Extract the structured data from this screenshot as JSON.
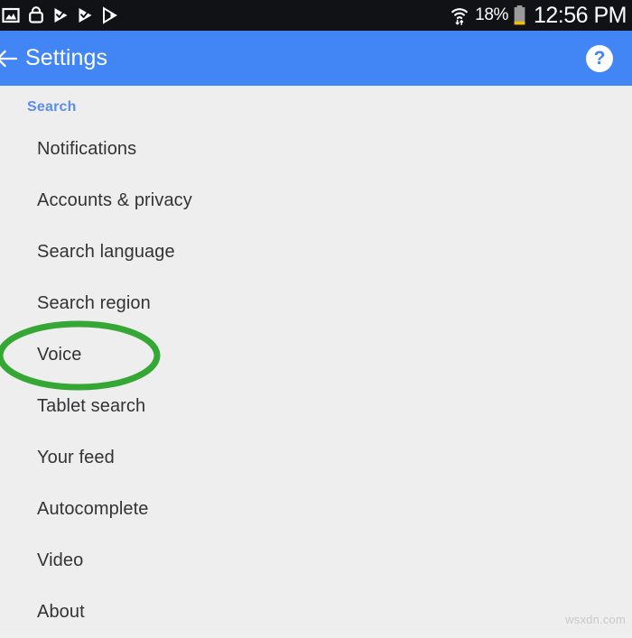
{
  "status_bar": {
    "icons_left": [
      {
        "name": "screenshot-icon",
        "label": "Screenshot"
      },
      {
        "name": "app-lock-icon",
        "label": "App lock"
      },
      {
        "name": "play-store-update-icon",
        "label": "Play Store update"
      },
      {
        "name": "play-store-update-icon-2",
        "label": "Play Store update"
      },
      {
        "name": "play-store-icon",
        "label": "Play Store"
      }
    ],
    "wifi_icon": "wifi-data-icon",
    "battery_percent": "18%",
    "battery_level": 18,
    "battery_icon": "battery-icon",
    "time": "12:56 PM",
    "background_color": "#111215",
    "text_color": "#ffffff"
  },
  "app_bar": {
    "back_icon": "back-arrow-icon",
    "title": "Settings",
    "help_icon": "help-question-icon",
    "help_label": "?",
    "background_color": "#4285f4",
    "text_color": "#ffffff"
  },
  "content": {
    "section_header": "Search",
    "section_header_color": "#5b8dee",
    "background_color": "#eeeeee",
    "items": [
      {
        "label": "Notifications",
        "highlighted": false
      },
      {
        "label": "Accounts & privacy",
        "highlighted": false
      },
      {
        "label": "Search language",
        "highlighted": false
      },
      {
        "label": "Search region",
        "highlighted": false
      },
      {
        "label": "Voice",
        "highlighted": true
      },
      {
        "label": "Tablet search",
        "highlighted": false
      },
      {
        "label": "Your feed",
        "highlighted": false
      },
      {
        "label": "Autocomplete",
        "highlighted": false
      },
      {
        "label": "Video",
        "highlighted": false
      },
      {
        "label": "About",
        "highlighted": false
      }
    ]
  },
  "annotation": {
    "shape": "ellipse",
    "target_item": "Voice",
    "color": "#35a735",
    "stroke_width": 7
  },
  "watermark": {
    "text": "wsxdn.com",
    "color": "#c9c9c9"
  }
}
